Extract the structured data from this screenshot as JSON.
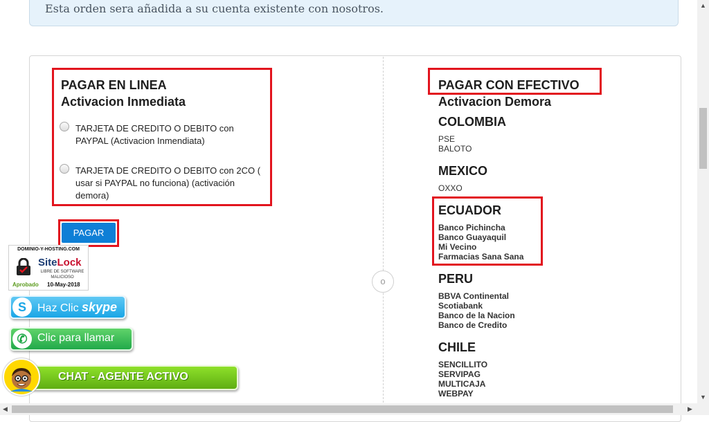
{
  "banner": {
    "text": "Esta orden sera añadida a su cuenta existente con nosotros."
  },
  "online": {
    "title": "PAGAR EN LINEA",
    "subtitle": "Activacion Inmediata",
    "options": [
      {
        "label": "TARJETA DE CREDITO O DEBITO con PAYPAL (Activacion Inmendiata)"
      },
      {
        "label": "TARJETA DE CREDITO O DEBITO con 2CO ( usar si PAYPAL no funciona) (activación demora)"
      }
    ],
    "pay_button": "PAGAR"
  },
  "divider_label": "o",
  "cash": {
    "title": "PAGAR CON EFECTIVO",
    "subtitle": "Activacion Demora",
    "countries": [
      {
        "name": "COLOMBIA",
        "methods": [
          "PSE",
          "BALOTO"
        ]
      },
      {
        "name": "MEXICO",
        "methods": [
          "OXXO"
        ]
      },
      {
        "name": "ECUADOR",
        "methods": [
          "Banco Pichincha",
          "Banco Guayaquil",
          "Mi Vecino",
          "Farmacias Sana Sana"
        ]
      },
      {
        "name": "PERU",
        "methods": [
          "BBVA Continental",
          "Scotiabank",
          "Banco de la Nacion",
          "Banco de Credito"
        ]
      },
      {
        "name": "CHILE",
        "methods": [
          "SENCILLITO",
          "SERVIPAG",
          "MULTICAJA",
          "WEBPAY"
        ]
      }
    ]
  },
  "sitelock": {
    "domain": "DOMINIO-Y-HOSTING.COM",
    "brand_a": "Site",
    "brand_b": "Lock",
    "line1": "LIBRE DE SOFTWARE",
    "line2": "MALICIOSO",
    "approved": "Aprobado",
    "date": "10-May-2018",
    "icon": "padlock-icon"
  },
  "widgets": {
    "skype_text": "Haz Clic",
    "skype_word": "skype",
    "skype_icon": "skype-icon",
    "whatsapp_text": "Clic para llamar",
    "whatsapp_icon": "whatsapp-icon",
    "chat_text": "CHAT - AGENTE ACTIVO"
  },
  "colors": {
    "highlight": "#e2141e",
    "button": "#0e7fd6",
    "banner_bg": "#e6f2fb"
  }
}
